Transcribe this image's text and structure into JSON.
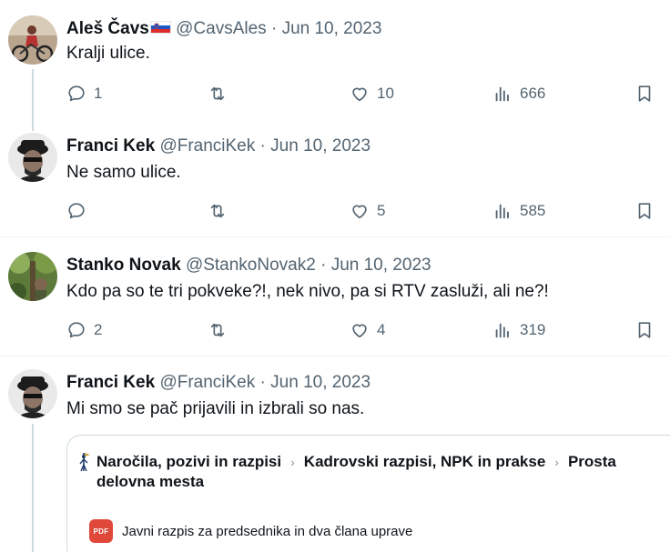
{
  "tweets": [
    {
      "name": "Aleš Čavs",
      "flag": "slovenia-flag",
      "handle": "@CavsAles",
      "sep": "·",
      "date": "Jun 10, 2023",
      "text": "Kralji ulice.",
      "replies": "1",
      "retweets": "",
      "likes": "10",
      "views": "666"
    },
    {
      "name": "Franci Kek",
      "handle": "@FranciKek",
      "sep": "·",
      "date": "Jun 10, 2023",
      "text": "Ne samo ulice.",
      "replies": "",
      "retweets": "",
      "likes": "5",
      "views": "585"
    },
    {
      "name": "Stanko Novak",
      "handle": "@StankoNovak2",
      "sep": "·",
      "date": "Jun 10, 2023",
      "text": "Kdo pa so te tri pokveke?!, nek nivo, pa si RTV zasluži, ali ne?!",
      "replies": "2",
      "retweets": "",
      "likes": "4",
      "views": "319"
    },
    {
      "name": "Franci Kek",
      "handle": "@FranciKek",
      "sep": "·",
      "date": "Jun 10, 2023",
      "text": "Mi smo se pač prijavili in izbrali so nas."
    }
  ],
  "card": {
    "crumb1": "Naročila, pozivi in razpisi",
    "crumb2": "Kadrovski razpisi, NPK in prakse",
    "crumb3": "Prosta delovna mesta",
    "separator": "›",
    "pdf_badge": "PDF",
    "pdf_title": "Javni razpis za predsednika in dva člana uprave"
  },
  "colors": {
    "text": "#0f1419",
    "muted": "#536471",
    "line": "#cfd9de",
    "pdf": "#e0483a"
  }
}
